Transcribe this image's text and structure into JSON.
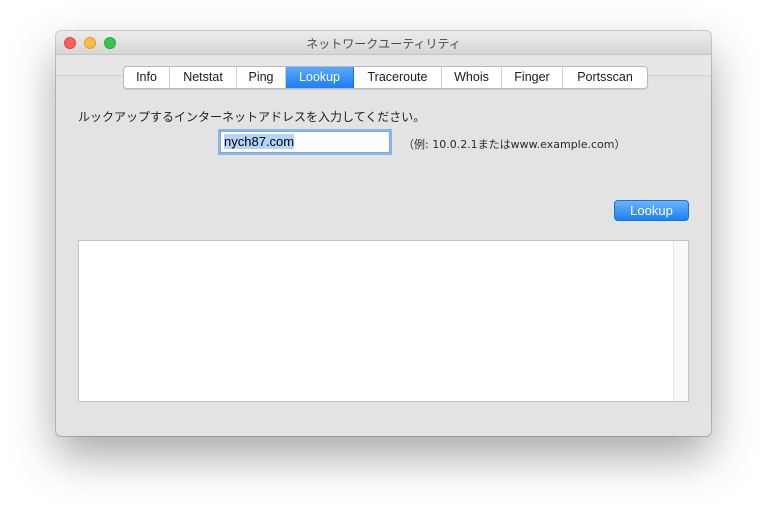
{
  "window": {
    "title": "ネットワークユーティリティ"
  },
  "tabs": [
    {
      "label": "Info",
      "active": false
    },
    {
      "label": "Netstat",
      "active": false
    },
    {
      "label": "Ping",
      "active": false
    },
    {
      "label": "Lookup",
      "active": true
    },
    {
      "label": "Traceroute",
      "active": false
    },
    {
      "label": "Whois",
      "active": false
    },
    {
      "label": "Finger",
      "active": false
    },
    {
      "label": "Portsscan",
      "active": false
    }
  ],
  "lookup": {
    "prompt": "ルックアップするインターネットアドレスを入力してください。",
    "address_value": "nych87.com",
    "example_hint": "（例: 10.0.2.1またはwww.example.com）",
    "button_label": "Lookup",
    "output_text": ""
  },
  "colors": {
    "accent": "#1d7ef5",
    "window_bg": "#e3e3e3"
  }
}
